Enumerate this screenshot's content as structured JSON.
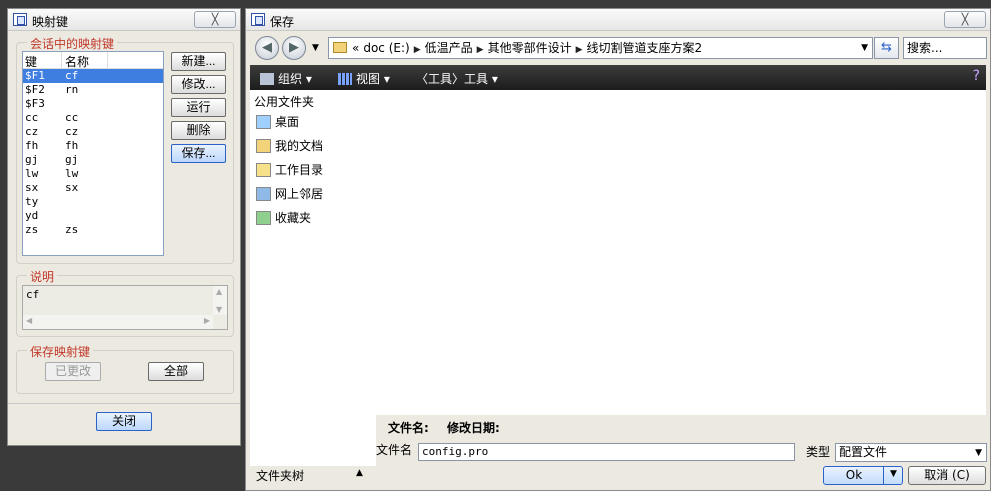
{
  "map_dialog": {
    "title": "映射键",
    "close_label": "╳",
    "session_group_title": "会话中的映射键",
    "list_headers": {
      "key": "键",
      "name": "名称"
    },
    "rows": [
      {
        "key": "$F1",
        "name": "cf"
      },
      {
        "key": "$F2",
        "name": "rn"
      },
      {
        "key": "$F3",
        "name": ""
      },
      {
        "key": "cc",
        "name": "cc"
      },
      {
        "key": "cz",
        "name": "cz"
      },
      {
        "key": "fh",
        "name": "fh"
      },
      {
        "key": "gj",
        "name": "gj"
      },
      {
        "key": "lw",
        "name": "lw"
      },
      {
        "key": "sx",
        "name": "sx"
      },
      {
        "key": "ty",
        "name": ""
      },
      {
        "key": "yd",
        "name": ""
      },
      {
        "key": "zs",
        "name": "zs"
      }
    ],
    "selected_row": 0,
    "buttons": {
      "new": "新建...",
      "modify": "修改...",
      "run": "运行",
      "delete": "删除",
      "save": "保存..."
    },
    "desc_group_title": "说明",
    "desc_text": "cf",
    "save_group_title": "保存映射键",
    "changed_label": "已更改",
    "all_label": "全部",
    "close_button": "关闭"
  },
  "save_dialog": {
    "title": "保存",
    "close_label": "╳",
    "address": {
      "prefix": "«",
      "crumbs": [
        "doc (E:)",
        "低温产品",
        "其他零部件设计",
        "线切割管道支座方案2"
      ]
    },
    "search_placeholder": "搜索...",
    "toolbar": {
      "organize": "组织",
      "view": "视图",
      "tools": "〈工具〉工具"
    },
    "nav_pane": {
      "header": "公用文件夹",
      "items": [
        {
          "label": "桌面",
          "icon": "desktop-icon"
        },
        {
          "label": "我的文档",
          "icon": "documents-icon"
        },
        {
          "label": "工作目录",
          "icon": "work-folder-icon"
        },
        {
          "label": "网上邻居",
          "icon": "network-icon"
        },
        {
          "label": "收藏夹",
          "icon": "favorites-icon"
        }
      ]
    },
    "columns": {
      "name": "文件名:",
      "modified": "修改日期:"
    },
    "filename_label": "文件名",
    "filename_value": "config.pro",
    "type_label": "类型",
    "type_value": "配置文件",
    "folder_tree_label": "文件夹树",
    "ok_label": "Ok",
    "cancel_label": "取消 (C)"
  },
  "colors": {
    "selection": "#3d7ee0",
    "group_title": "#c0392b",
    "toolbar": "#1c1c1c"
  }
}
